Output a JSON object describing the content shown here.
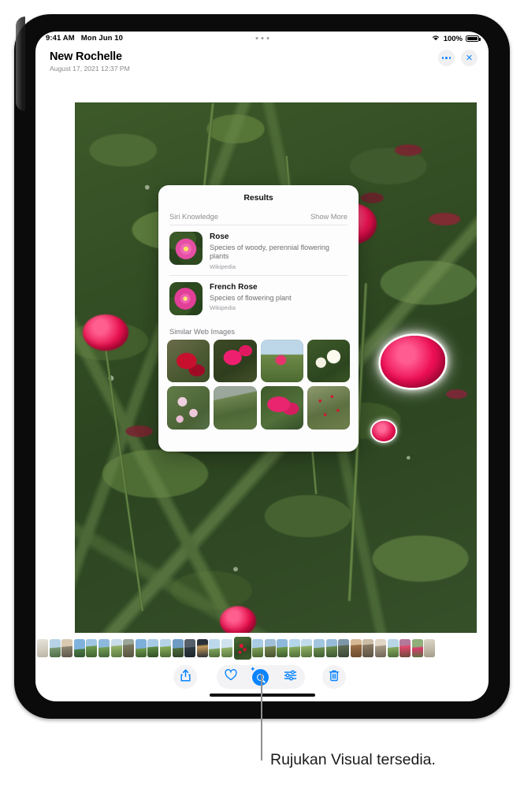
{
  "status_bar": {
    "time": "9:41 AM",
    "date": "Mon Jun 10",
    "wifi_icon": "wifi-icon",
    "battery_percent": "100%",
    "multitask_handle": "three-dots-handle"
  },
  "header": {
    "title": "New Rochelle",
    "subtitle": "August 17, 2021  12:37 PM",
    "more_button": "more-options-icon",
    "close_button": "✕"
  },
  "photo": {
    "name": "rose-bush-photo",
    "highlight_subject": "glowing-rose-outline"
  },
  "results_panel": {
    "title": "Results",
    "section_label": "Siri Knowledge",
    "show_more": "Show More",
    "items": [
      {
        "name": "Rose",
        "description": "Species of woody, perennial flowering plants",
        "source": "Wikipedia"
      },
      {
        "name": "French Rose",
        "description": "Species of flowering plant",
        "source": "Wikipedia"
      }
    ],
    "similar_label": "Similar Web Images",
    "similar_images": [
      "red-rose-closeup",
      "pink-roses-bush",
      "rose-with-sky",
      "white-roses",
      "pale-pink-roses",
      "rose-foliage",
      "magenta-rose-buds",
      "red-rose-shrub-with-label"
    ]
  },
  "toolbar": {
    "share_label": "share-icon",
    "favorite_label": "heart-icon",
    "visual_lookup_label": "visual-look-up-icon",
    "adjust_label": "adjust-sliders-icon",
    "delete_label": "trash-icon"
  },
  "filmstrip": {
    "name": "photo-filmstrip",
    "selected_index": 16
  },
  "callout": {
    "text": "Rujukan Visual tersedia."
  },
  "colors": {
    "accent": "#0a84ff",
    "secondary_text": "#8e8e93",
    "panel_bg": "#fdfdfd",
    "control_bg": "#f3f3f5"
  }
}
